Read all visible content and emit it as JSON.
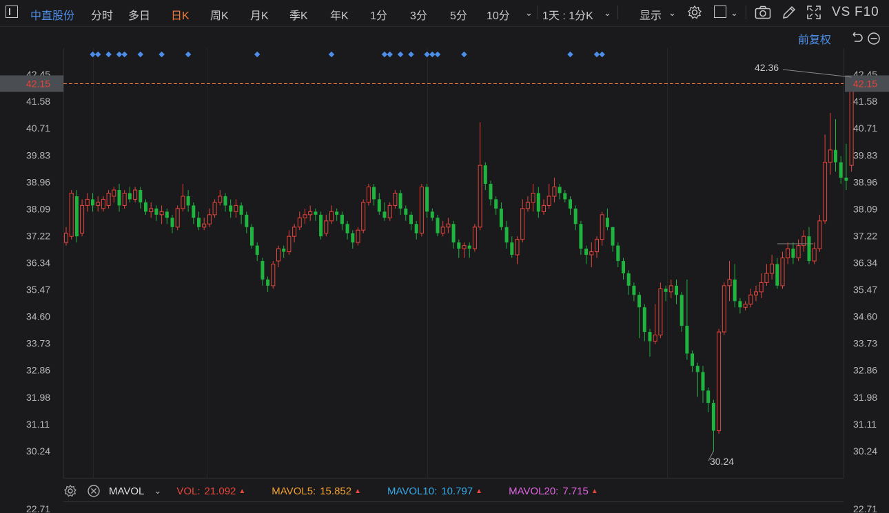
{
  "toolbar": {
    "stock_name": "中直股份",
    "periods": [
      "分时",
      "多日",
      "日K",
      "周K",
      "月K",
      "季K",
      "年K",
      "1分",
      "3分",
      "5分",
      "10分"
    ],
    "active_period": "日K",
    "interval_select": "1天 : 1分K",
    "display_label": "显示",
    "vs_label": "VS",
    "f10_label": "F10"
  },
  "subbar": {
    "adjust_label": "前复权"
  },
  "price_axis": {
    "ticks": [
      "42.45",
      "41.58",
      "40.71",
      "39.83",
      "38.96",
      "38.09",
      "37.22",
      "36.34",
      "35.47",
      "34.60",
      "33.73",
      "32.86",
      "31.98",
      "31.11",
      "30.24"
    ],
    "current_price": "42.15",
    "max_label": "42.36",
    "min_label": "30.24"
  },
  "volume_axis": {
    "top_tick": "22.71"
  },
  "volume_legend": {
    "indicator": "MAVOL",
    "vol_label": "VOL:",
    "vol_value": "21.092",
    "mavol5_label": "MAVOL5:",
    "mavol5_value": "15.852",
    "mavol10_label": "MAVOL10:",
    "mavol10_value": "10.797",
    "mavol20_label": "MAVOL20:",
    "mavol20_value": "7.715"
  },
  "colors": {
    "up": "#e8453c",
    "down": "#1fb33f",
    "accent": "#f0793a",
    "stock": "#4c8ee8",
    "marker": "#4c8ee8",
    "mavol5": "#f0a030",
    "mavol10": "#35a9e8",
    "mavol20": "#e065e0"
  },
  "chart_data": {
    "type": "candlestick",
    "price_range": [
      30.24,
      42.45
    ],
    "candles": [
      [
        37.0,
        37.3,
        36.9,
        37.5
      ],
      [
        37.2,
        38.6,
        37.1,
        38.7
      ],
      [
        38.5,
        37.2,
        37.0,
        38.7
      ],
      [
        37.3,
        38.2,
        37.2,
        38.4
      ],
      [
        38.2,
        38.4,
        38.0,
        38.6
      ],
      [
        38.4,
        38.2,
        38.0,
        38.6
      ],
      [
        38.2,
        38.3,
        38.0,
        38.5
      ],
      [
        38.1,
        38.4,
        38.0,
        38.5
      ],
      [
        38.2,
        38.6,
        38.1,
        38.7
      ],
      [
        38.5,
        38.7,
        38.3,
        38.8
      ],
      [
        38.7,
        38.2,
        38.0,
        38.9
      ],
      [
        38.2,
        38.6,
        38.1,
        38.7
      ],
      [
        38.6,
        38.4,
        38.3,
        38.8
      ],
      [
        38.4,
        38.7,
        38.3,
        38.8
      ],
      [
        38.7,
        38.3,
        38.1,
        38.8
      ],
      [
        38.3,
        38.0,
        37.9,
        38.4
      ],
      [
        38.0,
        38.1,
        37.8,
        38.3
      ],
      [
        38.1,
        37.9,
        37.7,
        38.2
      ],
      [
        37.9,
        38.0,
        37.6,
        38.2
      ],
      [
        38.0,
        37.8,
        37.6,
        38.1
      ],
      [
        37.8,
        37.5,
        37.3,
        37.9
      ],
      [
        37.5,
        38.1,
        37.4,
        38.2
      ],
      [
        38.1,
        38.5,
        38.0,
        38.9
      ],
      [
        38.5,
        38.2,
        38.0,
        38.7
      ],
      [
        38.2,
        37.8,
        37.6,
        38.3
      ],
      [
        37.8,
        37.5,
        37.4,
        38.0
      ],
      [
        37.5,
        37.6,
        37.4,
        37.8
      ],
      [
        37.6,
        37.9,
        37.5,
        38.1
      ],
      [
        37.9,
        38.3,
        37.8,
        38.4
      ],
      [
        38.3,
        38.5,
        38.2,
        38.7
      ],
      [
        38.5,
        38.2,
        38.0,
        38.6
      ],
      [
        38.2,
        38.0,
        37.8,
        38.4
      ],
      [
        38.0,
        38.2,
        37.8,
        38.4
      ],
      [
        38.2,
        37.9,
        37.6,
        38.3
      ],
      [
        37.9,
        37.5,
        37.3,
        38.0
      ],
      [
        37.5,
        36.9,
        36.8,
        37.6
      ],
      [
        36.9,
        36.6,
        36.4,
        37.0
      ],
      [
        36.4,
        35.8,
        35.6,
        36.5
      ],
      [
        35.8,
        35.6,
        35.4,
        35.9
      ],
      [
        35.6,
        36.3,
        35.5,
        36.4
      ],
      [
        36.4,
        36.8,
        36.2,
        36.9
      ],
      [
        36.8,
        36.7,
        36.5,
        36.9
      ],
      [
        36.7,
        37.2,
        36.6,
        37.4
      ],
      [
        37.2,
        37.5,
        37.0,
        37.6
      ],
      [
        37.5,
        37.8,
        37.4,
        38.0
      ],
      [
        37.8,
        37.9,
        37.6,
        38.1
      ],
      [
        37.9,
        38.0,
        37.7,
        38.2
      ],
      [
        38.0,
        37.9,
        37.7,
        38.1
      ],
      [
        37.9,
        37.2,
        37.1,
        38.0
      ],
      [
        37.3,
        37.7,
        37.2,
        37.9
      ],
      [
        37.7,
        38.0,
        37.6,
        38.2
      ],
      [
        38.0,
        37.9,
        37.7,
        38.1
      ],
      [
        37.9,
        37.6,
        37.4,
        38.0
      ],
      [
        37.6,
        37.3,
        37.1,
        37.7
      ],
      [
        37.3,
        37.0,
        36.8,
        37.4
      ],
      [
        37.0,
        37.4,
        36.9,
        37.5
      ],
      [
        37.4,
        38.3,
        37.3,
        38.4
      ],
      [
        38.3,
        38.8,
        38.2,
        38.9
      ],
      [
        38.8,
        38.4,
        38.2,
        38.9
      ],
      [
        38.4,
        38.0,
        37.9,
        38.6
      ],
      [
        38.0,
        37.8,
        37.7,
        38.3
      ],
      [
        37.8,
        38.2,
        37.7,
        38.3
      ],
      [
        38.2,
        38.6,
        38.1,
        38.7
      ],
      [
        38.6,
        38.1,
        37.9,
        38.7
      ],
      [
        38.1,
        37.9,
        37.7,
        38.2
      ],
      [
        37.9,
        37.6,
        37.4,
        38.0
      ],
      [
        37.6,
        37.3,
        37.1,
        37.7
      ],
      [
        37.3,
        38.8,
        37.2,
        38.9
      ],
      [
        38.8,
        38.0,
        37.8,
        38.9
      ],
      [
        38.0,
        37.8,
        37.7,
        38.1
      ],
      [
        37.8,
        37.3,
        37.2,
        37.9
      ],
      [
        37.3,
        37.5,
        37.2,
        37.7
      ],
      [
        37.5,
        37.6,
        37.3,
        37.8
      ],
      [
        37.6,
        37.0,
        36.8,
        37.7
      ],
      [
        37.0,
        36.8,
        36.5,
        37.1
      ],
      [
        36.8,
        36.9,
        36.5,
        37.0
      ],
      [
        36.9,
        36.8,
        36.5,
        37.0
      ],
      [
        36.8,
        37.5,
        36.7,
        37.6
      ],
      [
        37.5,
        39.5,
        37.4,
        40.9
      ],
      [
        39.5,
        38.9,
        38.7,
        39.6
      ],
      [
        38.9,
        38.4,
        38.2,
        39.0
      ],
      [
        38.4,
        38.1,
        37.9,
        38.5
      ],
      [
        38.1,
        37.5,
        37.4,
        38.3
      ],
      [
        37.5,
        37.0,
        36.8,
        37.7
      ],
      [
        37.0,
        36.6,
        36.5,
        37.2
      ],
      [
        36.6,
        37.1,
        36.3,
        37.2
      ],
      [
        37.1,
        38.1,
        37.0,
        38.4
      ],
      [
        38.1,
        38.3,
        38.0,
        38.5
      ],
      [
        38.3,
        38.6,
        38.0,
        38.9
      ],
      [
        38.6,
        38.0,
        37.8,
        38.8
      ],
      [
        38.0,
        38.2,
        37.9,
        38.4
      ],
      [
        38.2,
        38.5,
        38.1,
        38.9
      ],
      [
        38.5,
        38.8,
        38.3,
        39.1
      ],
      [
        38.8,
        38.6,
        38.4,
        38.9
      ],
      [
        38.6,
        38.4,
        38.3,
        38.7
      ],
      [
        38.4,
        38.1,
        37.9,
        38.5
      ],
      [
        38.1,
        37.6,
        37.4,
        38.2
      ],
      [
        37.6,
        36.8,
        36.6,
        37.7
      ],
      [
        36.8,
        36.6,
        36.3,
        36.9
      ],
      [
        36.6,
        36.7,
        36.2,
        37.0
      ],
      [
        36.7,
        37.1,
        36.5,
        37.2
      ],
      [
        37.1,
        37.9,
        36.9,
        38.0
      ],
      [
        37.8,
        37.5,
        37.4,
        38.1
      ],
      [
        37.5,
        36.9,
        36.7,
        37.5
      ],
      [
        36.9,
        36.4,
        36.2,
        37.0
      ],
      [
        36.4,
        36.0,
        35.8,
        36.5
      ],
      [
        36.0,
        35.6,
        35.3,
        36.1
      ],
      [
        35.6,
        35.3,
        35.1,
        35.7
      ],
      [
        35.3,
        34.9,
        33.9,
        35.4
      ],
      [
        34.9,
        34.1,
        33.8,
        35.0
      ],
      [
        34.1,
        33.8,
        33.3,
        34.2
      ],
      [
        33.8,
        34.0,
        33.7,
        35.0
      ],
      [
        34.0,
        35.5,
        33.9,
        35.7
      ],
      [
        35.5,
        35.4,
        35.1,
        35.6
      ],
      [
        35.4,
        35.6,
        35.2,
        35.8
      ],
      [
        35.6,
        35.3,
        35.0,
        35.8
      ],
      [
        35.3,
        34.3,
        34.1,
        35.4
      ],
      [
        34.3,
        33.4,
        33.2,
        35.8
      ],
      [
        33.4,
        33.0,
        32.8,
        33.5
      ],
      [
        33.0,
        32.8,
        32.0,
        33.1
      ],
      [
        32.8,
        32.2,
        31.8,
        33.0
      ],
      [
        32.2,
        31.8,
        31.5,
        32.3
      ],
      [
        31.8,
        30.9,
        30.24,
        31.9
      ],
      [
        30.9,
        34.1,
        30.8,
        34.2
      ],
      [
        34.1,
        35.6,
        34.0,
        35.7
      ],
      [
        35.6,
        35.8,
        35.1,
        36.4
      ],
      [
        35.8,
        35.1,
        34.9,
        36.3
      ],
      [
        35.1,
        34.9,
        34.7,
        35.2
      ],
      [
        34.9,
        35.0,
        34.8,
        35.1
      ],
      [
        35.0,
        35.3,
        34.9,
        35.5
      ],
      [
        35.3,
        35.4,
        35.1,
        35.6
      ],
      [
        35.4,
        35.7,
        35.2,
        36.0
      ],
      [
        35.7,
        36.0,
        35.6,
        36.3
      ],
      [
        36.0,
        36.3,
        35.8,
        36.6
      ],
      [
        36.3,
        35.6,
        35.5,
        36.5
      ],
      [
        35.6,
        36.5,
        35.5,
        36.7
      ],
      [
        36.5,
        36.8,
        36.3,
        37.0
      ],
      [
        36.8,
        36.5,
        36.3,
        37.0
      ],
      [
        36.5,
        36.9,
        36.4,
        37.1
      ],
      [
        36.9,
        37.2,
        36.7,
        37.4
      ],
      [
        37.2,
        36.4,
        36.3,
        37.5
      ],
      [
        36.4,
        36.8,
        36.3,
        37.0
      ],
      [
        36.8,
        37.7,
        36.7,
        37.9
      ],
      [
        37.7,
        39.6,
        37.6,
        40.5
      ],
      [
        39.6,
        40.0,
        39.2,
        41.2
      ],
      [
        40.0,
        39.6,
        39.3,
        41.0
      ],
      [
        39.6,
        39.1,
        38.9,
        39.8
      ],
      [
        39.1,
        39.0,
        38.7,
        40.2
      ],
      [
        39.5,
        42.15,
        39.3,
        42.36
      ]
    ],
    "markers": [
      5,
      6,
      8,
      10,
      11,
      14,
      18,
      23,
      36,
      50,
      60,
      61,
      63,
      65,
      68,
      69,
      70,
      75,
      95,
      100,
      101
    ]
  }
}
